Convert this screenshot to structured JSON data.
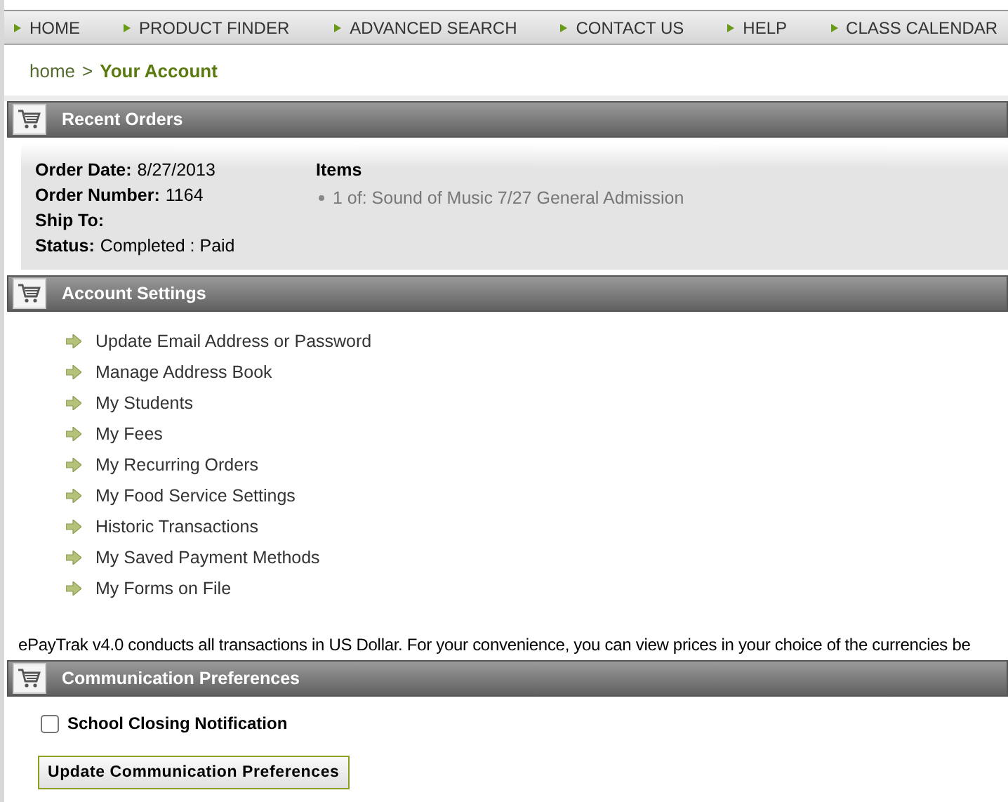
{
  "nav": [
    "HOME",
    "PRODUCT FINDER",
    "ADVANCED SEARCH",
    "CONTACT US",
    "HELP",
    "CLASS CALENDAR"
  ],
  "breadcrumb": {
    "home": "home",
    "separator": ">",
    "current": "Your Account"
  },
  "recent_orders": {
    "title": "Recent Orders",
    "fields": [
      {
        "label": "Order Date:",
        "value": "8/27/2013"
      },
      {
        "label": "Order Number:",
        "value": "1164"
      },
      {
        "label": "Ship To:"
      },
      {
        "label": "Status:",
        "value": "Completed : Paid"
      }
    ],
    "items_heading": "Items",
    "items": [
      "1 of: Sound of Music 7/27 General Admission"
    ]
  },
  "account_settings": {
    "title": "Account Settings",
    "links": [
      "Update Email Address or Password",
      "Manage Address Book",
      "My Students",
      "My Fees",
      "My Recurring Orders",
      "My Food Service Settings",
      "Historic Transactions",
      "My Saved Payment Methods",
      "My Forms on File"
    ]
  },
  "currency_note": "ePayTrak v4.0 conducts all transactions in US Dollar. For your convenience, you can view prices in your choice of the currencies be",
  "communication": {
    "title": "Communication Preferences",
    "options": [
      {
        "label": "School Closing Notification",
        "checked": false
      }
    ],
    "button": "Update Communication Preferences"
  }
}
